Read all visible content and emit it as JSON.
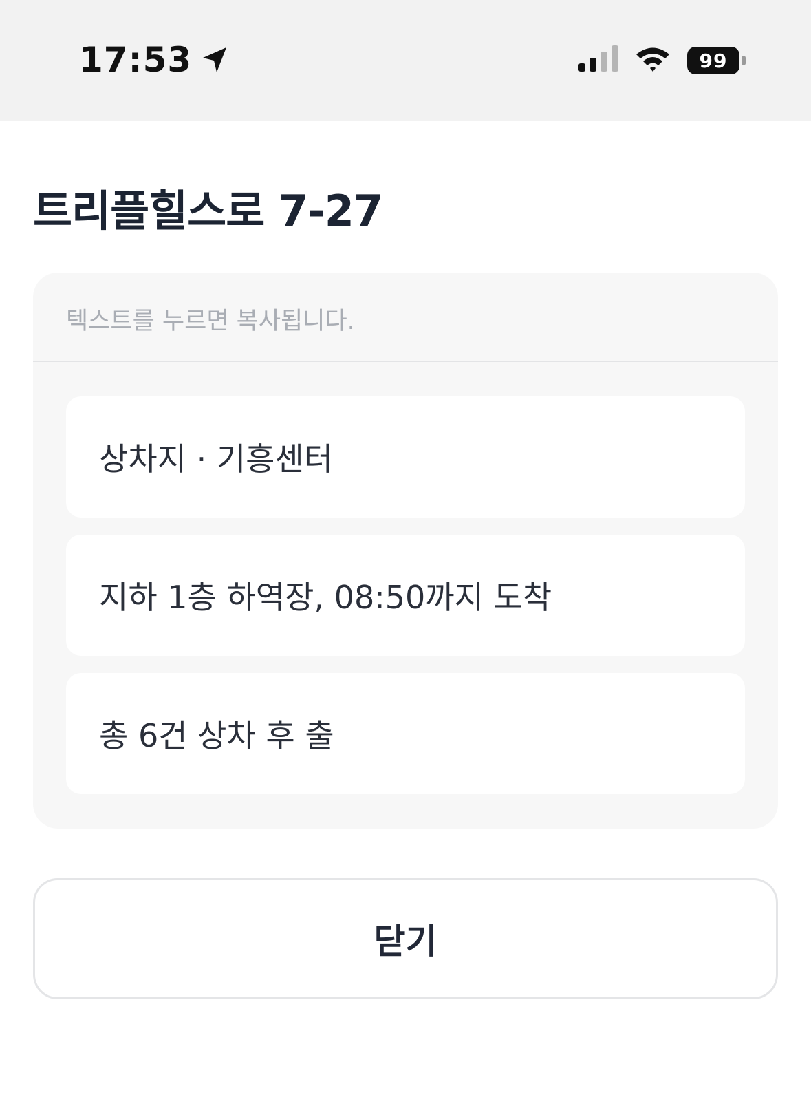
{
  "status_bar": {
    "time": "17:53",
    "battery": "99",
    "icons": [
      "location-arrow-icon",
      "signal-icon",
      "wifi-icon",
      "battery-icon"
    ]
  },
  "title": "트리플힐스로 7-27",
  "copy_hint": "텍스트를 누르면 복사됩니다.",
  "items": [
    {
      "label": "상차지 · 기흥센터"
    },
    {
      "label": "지하 1층 하역장, 08:50까지 도착"
    },
    {
      "label": "총 6건 상차 후 출"
    }
  ],
  "close_label": "닫기"
}
